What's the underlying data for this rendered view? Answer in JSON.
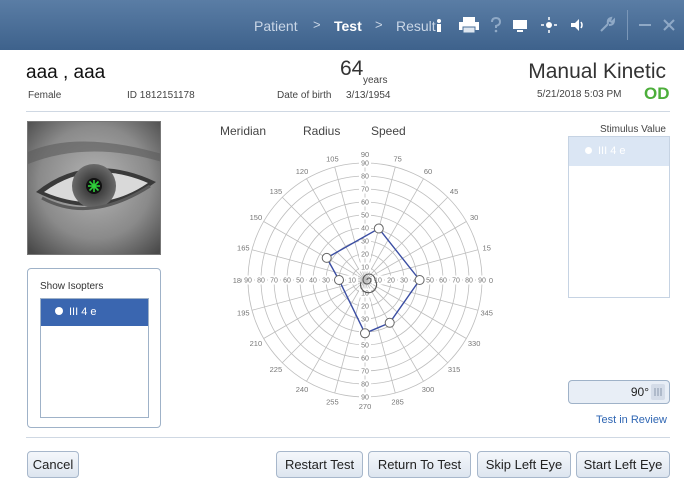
{
  "workflow": {
    "steps": [
      "Patient",
      "Test",
      "Result"
    ],
    "active": "Test",
    "separator": ">"
  },
  "toolbar_icons": [
    "info-icon",
    "print-icon",
    "help-icon",
    "display-icon",
    "brightness-icon",
    "sound-icon",
    "wrench-icon",
    "minimize-icon",
    "close-icon"
  ],
  "patient": {
    "name": "aaa , aaa",
    "sex": "Female",
    "id": "ID 1812151178",
    "age": "64",
    "age_unit": "years",
    "dob_label": "Date of birth",
    "dob": "3/13/1954"
  },
  "test": {
    "name": "Manual Kinetic",
    "datetime": "5/21/2018 5:03 PM",
    "eye": "OD"
  },
  "isopters": {
    "title": "Show Isopters",
    "items": [
      "III 4 e"
    ]
  },
  "plot_controls": [
    "Meridian",
    "Radius",
    "Speed"
  ],
  "stimulus": {
    "title": "Stimulus Value",
    "items": [
      "III 4 e"
    ]
  },
  "meridian_value": "90°",
  "status_link": "Test in Review",
  "buttons": {
    "cancel": "Cancel",
    "restart": "Restart Test",
    "return": "Return To Test",
    "skip": "Skip Left Eye",
    "start": "Start Left Eye"
  },
  "polar_chart": {
    "angle_labels": [
      "0",
      "15",
      "30",
      "45",
      "60",
      "75",
      "90",
      "105",
      "120",
      "135",
      "150",
      "165",
      "180",
      "195",
      "210",
      "225",
      "240",
      "255",
      "270",
      "285",
      "300",
      "315",
      "330",
      "345"
    ],
    "radius_labels": [
      "10",
      "20",
      "30",
      "40",
      "50",
      "60",
      "70",
      "80",
      "90"
    ],
    "isopter": {
      "name": "III 4 e",
      "points": [
        {
          "angle": 75,
          "radius": 41
        },
        {
          "angle": 0,
          "radius": 42
        },
        {
          "angle": 300,
          "radius": 38
        },
        {
          "angle": 270,
          "radius": 41
        },
        {
          "angle": 180,
          "radius": 20
        },
        {
          "angle": 150,
          "radius": 34
        }
      ]
    }
  },
  "colors": {
    "topbar": "#4a6f99",
    "isopter": "#3b4ea3",
    "eye_label": "#4cae3a",
    "selection": "#3a66b0",
    "link": "#2f66b3"
  }
}
